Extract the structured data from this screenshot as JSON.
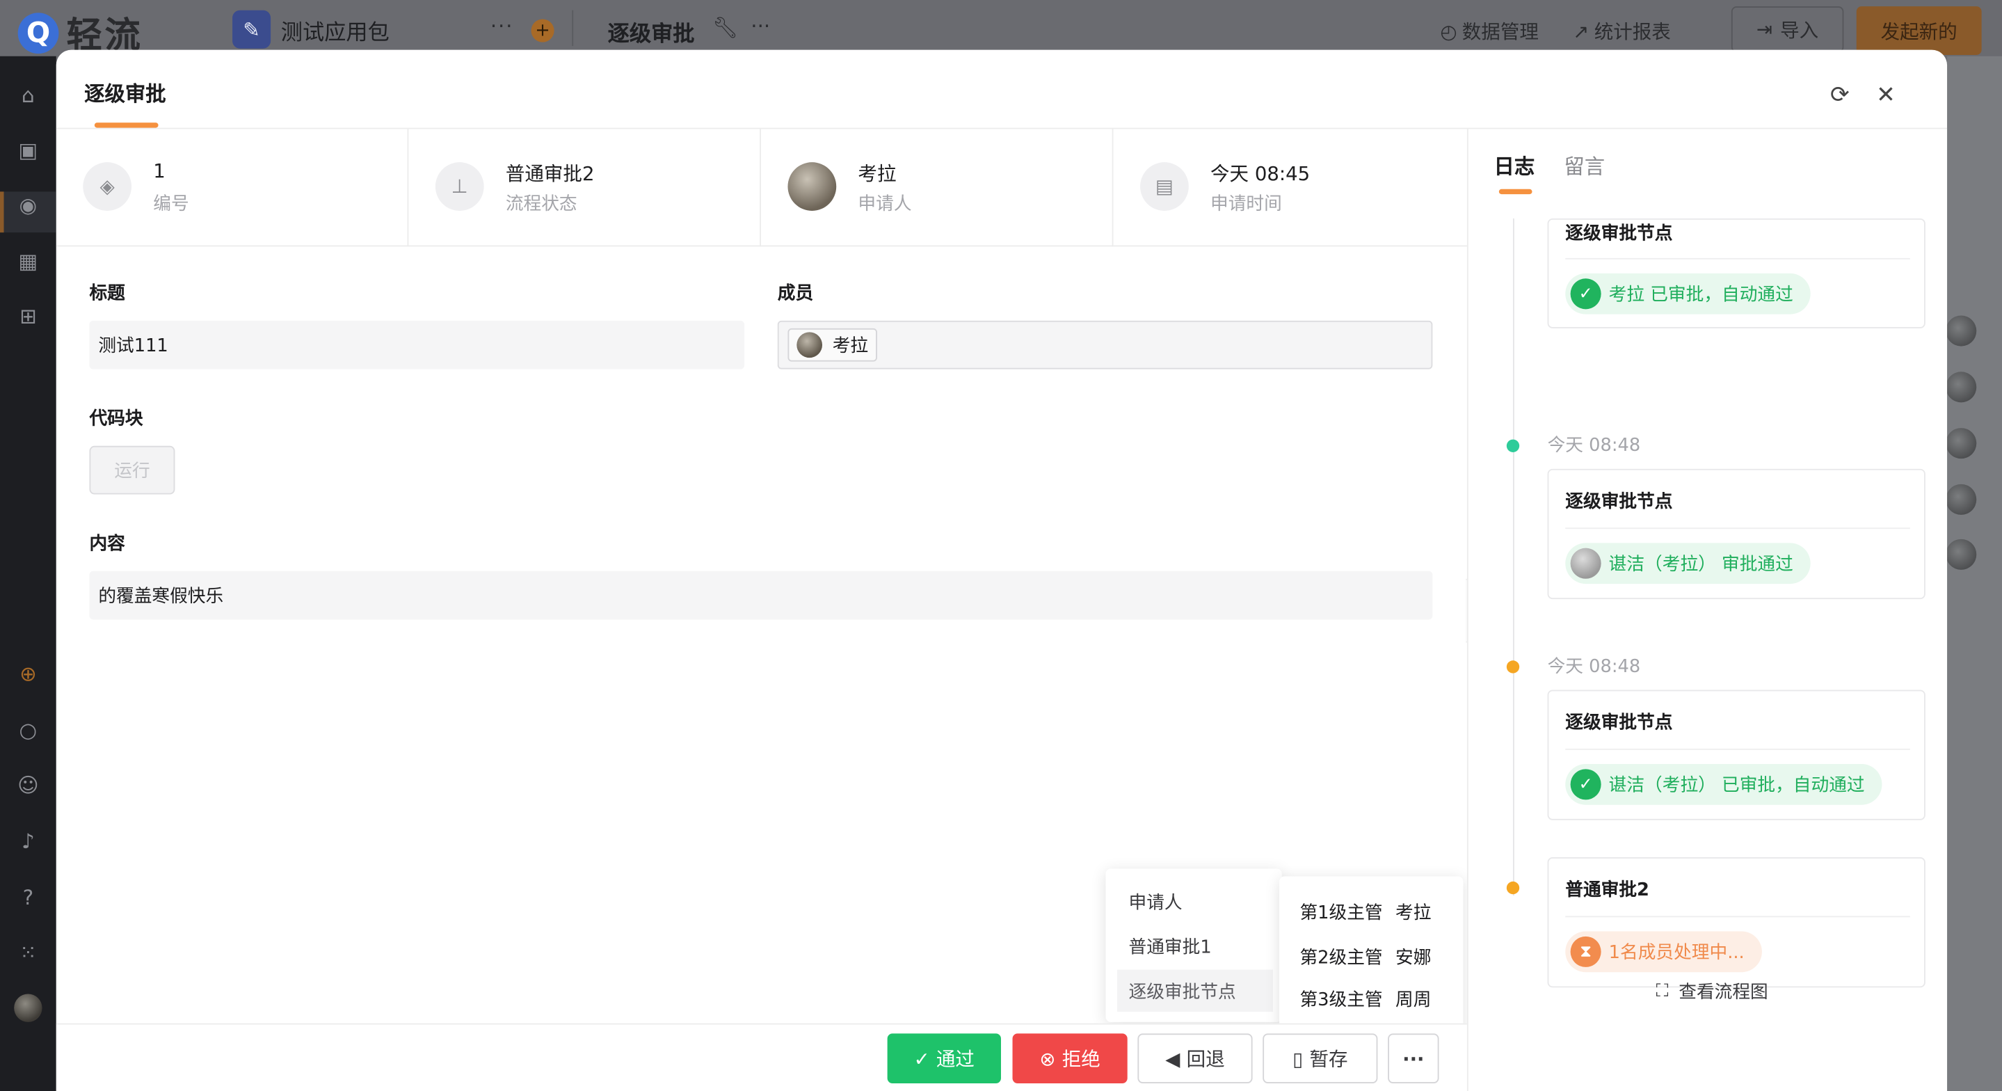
{
  "app": {
    "logo_text": "轻流",
    "package_name": "测试应用包",
    "app_title": "逐级审批",
    "nav": {
      "data_manage": "数据管理",
      "stats": "统计报表",
      "import": "导入",
      "start_new": "发起新的"
    }
  },
  "modal": {
    "title": "逐级审批",
    "info": [
      {
        "value": "1",
        "label": "编号",
        "icon": "tag-icon"
      },
      {
        "value": "普通审批2",
        "label": "流程状态",
        "icon": "flow-icon"
      },
      {
        "value": "考拉",
        "label": "申请人",
        "icon": "avatar"
      },
      {
        "value": "今天 08:45",
        "label": "申请时间",
        "icon": "calendar-icon"
      }
    ],
    "form": {
      "title_label": "标题",
      "title_value": "测试111",
      "member_label": "成员",
      "member_value": "考拉",
      "code_label": "代码块",
      "run_label": "运行",
      "content_label": "内容",
      "content_value": "的覆盖寒假快乐"
    },
    "footer": {
      "pass": "通过",
      "reject": "拒绝",
      "back": "回退",
      "save": "暂存",
      "more": "···"
    },
    "rollback_menu": {
      "items": [
        "申请人",
        "普通审批1",
        "逐级审批节点"
      ],
      "sub_items": [
        {
          "level": "第1级主管",
          "name": "考拉"
        },
        {
          "level": "第2级主管",
          "name": "安娜"
        },
        {
          "level": "第3级主管",
          "name": "周周"
        }
      ]
    }
  },
  "panel": {
    "tabs": [
      "日志",
      "留言"
    ],
    "entries": [
      {
        "time": "",
        "node": "逐级审批节点",
        "status": "考拉 已审批，自动通过",
        "kind": "green"
      },
      {
        "time": "今天 08:48",
        "node": "逐级审批节点",
        "status": "谌洁（考拉） 审批通过",
        "kind": "avatar"
      },
      {
        "time": "今天 08:48",
        "node": "逐级审批节点",
        "status": "谌洁（考拉） 已审批，自动通过",
        "kind": "green"
      },
      {
        "time": "",
        "node": "普通审批2",
        "status": "1名成员处理中...",
        "kind": "orange"
      }
    ],
    "flow_link": "查看流程图"
  },
  "colors": {
    "accent": "#f5913f",
    "pass": "#1ec26a",
    "reject": "#f04848",
    "dot_green": "#2ecc9a",
    "dot_orange": "#f5a623"
  }
}
